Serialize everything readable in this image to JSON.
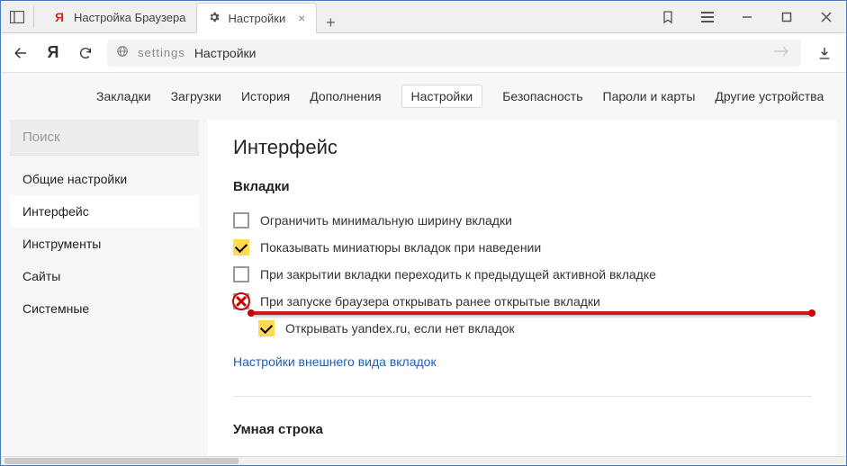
{
  "tabs": [
    {
      "label": "Настройка Браузера",
      "icon": "yandex"
    },
    {
      "label": "Настройки",
      "icon": "gear"
    }
  ],
  "url": {
    "prefix": "settings",
    "title": "Настройки"
  },
  "topnav": {
    "items": [
      "Закладки",
      "Загрузки",
      "История",
      "Дополнения",
      "Настройки",
      "Безопасность",
      "Пароли и карты",
      "Другие устройства"
    ],
    "active_index": 4
  },
  "sidebar": {
    "search_placeholder": "Поиск",
    "items": [
      "Общие настройки",
      "Интерфейс",
      "Инструменты",
      "Сайты",
      "Системные"
    ],
    "active_index": 1
  },
  "content": {
    "heading": "Интерфейс",
    "section1_title": "Вкладки",
    "options": [
      {
        "label": "Ограничить минимальную ширину вкладки",
        "checked": false
      },
      {
        "label": "Показывать миниатюры вкладок при наведении",
        "checked": true
      },
      {
        "label": "При закрытии вкладки переходить к предыдущей активной вкладке",
        "checked": false
      },
      {
        "label": "При запуске браузера открывать ранее открытые вкладки",
        "checked": false,
        "annotated": true
      },
      {
        "label": "Открывать yandex.ru, если нет вкладок",
        "checked": true,
        "indent": true
      }
    ],
    "link_text": "Настройки внешнего вида вкладок",
    "section2_title": "Умная строка"
  }
}
